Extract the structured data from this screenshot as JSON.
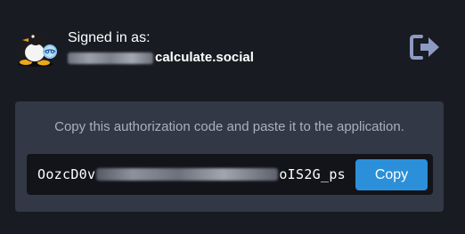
{
  "account": {
    "signed_in_label": "Signed in as:",
    "account_handle_visible": "calculate.social",
    "avatar_icon": "penguin-avatar-icon",
    "logout_icon": "sign-out-icon"
  },
  "authorization": {
    "instructions": "Copy this authorization code and paste it to the application.",
    "code_prefix": "OozcD0v",
    "code_suffix": "oIS2G_ps",
    "copy_button_label": "Copy"
  },
  "colors": {
    "background": "#191b22",
    "panel": "#323845",
    "code_box": "#12141a",
    "accent": "#2b90d9",
    "muted_text": "#a7b0c2",
    "logout_icon": "#8d9ac2"
  }
}
